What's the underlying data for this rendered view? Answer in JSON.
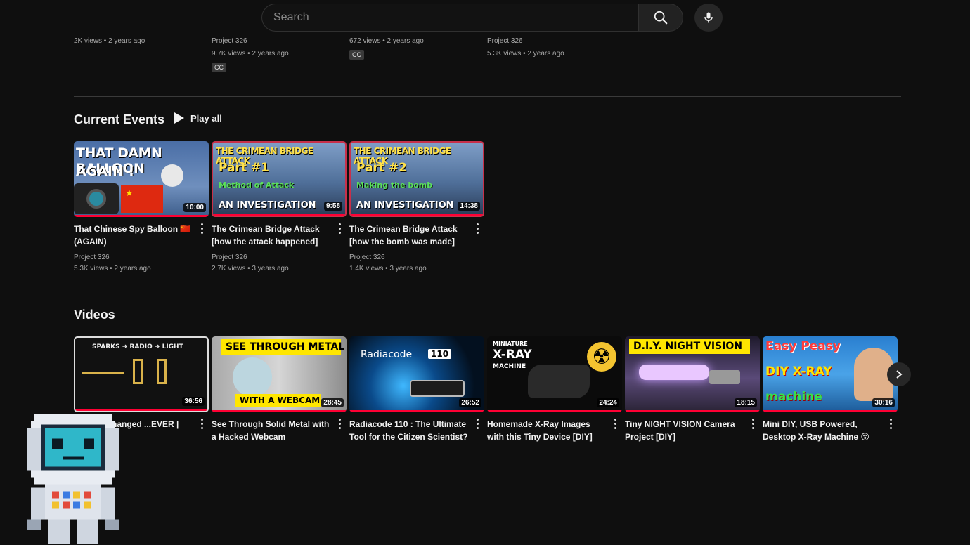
{
  "search": {
    "placeholder": "Search"
  },
  "previous_row": [
    {
      "channel": "",
      "views": "2K views",
      "age": "2 years ago",
      "cc": ""
    },
    {
      "channel": "Project 326",
      "views": "9.7K views",
      "age": "2 years ago",
      "cc": "CC"
    },
    {
      "channel": "",
      "views": "672 views",
      "age": "2 years ago",
      "cc": "CC"
    },
    {
      "channel": "Project 326",
      "views": "5.3K views",
      "age": "2 years ago",
      "cc": ""
    }
  ],
  "current_events": {
    "title": "Current Events",
    "play_all": "Play all",
    "items": [
      {
        "title": "That Chinese Spy Balloon 🇨🇳 (AGAIN)",
        "channel": "Project 326",
        "views": "5.3K views",
        "age": "2 years ago",
        "duration": "10:00",
        "thumb": {
          "line1": "THAT DAMN BALLOON",
          "line2": "AGAIN !"
        }
      },
      {
        "title": "The Crimean Bridge Attack [how the attack happened]",
        "channel": "Project 326",
        "views": "2.7K views",
        "age": "3 years ago",
        "duration": "9:58",
        "thumb": {
          "line1": "THE CRIMEAN BRIDGE ATTACK",
          "line2": "Part #1",
          "line3": "Method of Attack",
          "line4": "AN INVESTIGATION"
        }
      },
      {
        "title": "The Crimean Bridge Attack [how the bomb was made]",
        "channel": "Project 326",
        "views": "1.4K views",
        "age": "3 years ago",
        "duration": "14:38",
        "thumb": {
          "line1": "THE CRIMEAN BRIDGE ATTACK",
          "line2": "Part #2",
          "line3": "Making the bomb",
          "line4": "AN INVESTIGATION"
        }
      }
    ]
  },
  "videos": {
    "title": "Videos",
    "items": [
      {
        "title": "...iment Changed ...EVER | Easy to...",
        "duration": "36:56",
        "thumb": {
          "line1": "SPARKS ➜ RADIO ➜ LIGHT"
        }
      },
      {
        "title": "See Through Solid Metal with a Hacked Webcam",
        "duration": "28:45",
        "thumb": {
          "line1": "SEE THROUGH METAL",
          "line2": "WITH A WEBCAM"
        }
      },
      {
        "title": "Radiacode 110 : The Ultimate Tool for the Citizen Scientist?",
        "duration": "26:52",
        "thumb": {
          "line1": "Radiacode",
          "line2": "110"
        }
      },
      {
        "title": "Homemade X-Ray Images with this Tiny Device [DIY]",
        "duration": "24:24",
        "thumb": {
          "line1": "MINIATURE",
          "line2": "X-RAY",
          "line3": "MACHINE"
        }
      },
      {
        "title": "Tiny NIGHT VISION Camera Project [DIY]",
        "duration": "18:15",
        "thumb": {
          "line1": "D.I.Y. NIGHT VISION"
        }
      },
      {
        "title": "Mini DIY, USB Powered, Desktop X-Ray Machine 😵",
        "duration": "30:16",
        "thumb": {
          "line1": "Easy Peasy",
          "line2": "DIY X-RAY",
          "line3": "machine"
        }
      }
    ]
  },
  "colors": {
    "background": "#0f0f0f",
    "progress": "#ff0033",
    "text": "#f1f1f1",
    "meta": "#aaaaaa"
  }
}
